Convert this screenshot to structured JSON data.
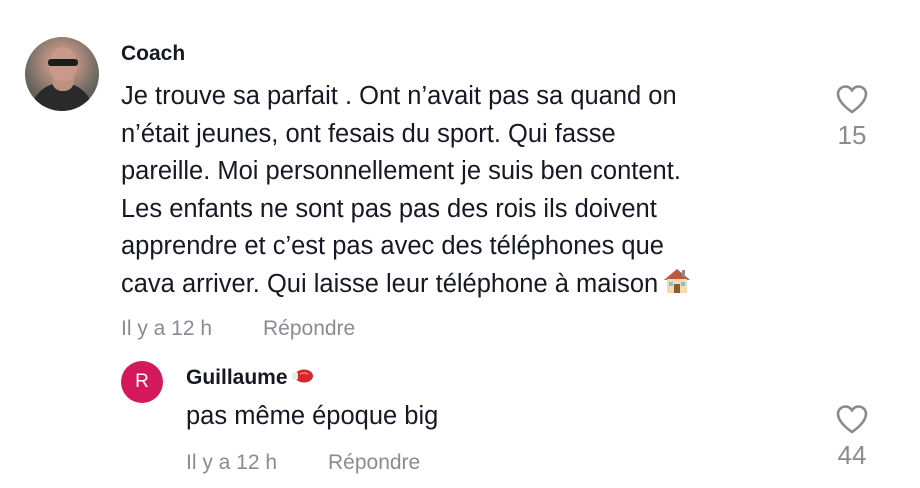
{
  "comment": {
    "username": "Coach",
    "text": "Je trouve sa parfait . Ont n’avait pas sa quand on\nn’était jeunes, ont fesais du sport. Qui fasse\npareille. Moi personnellement je suis ben content.\nLes enfants ne sont pas pas des rois ils doivent\napprendre et c’est pas avec des téléphones que\ncava arriver. Qui laisse leur téléphone à maison",
    "emoji": "house-icon",
    "timestamp": "Il y a 12 h",
    "reply_label": "Répondre",
    "like_count": "15",
    "like_icon": "heart-outline-icon"
  },
  "reply": {
    "avatar_letter": "R",
    "avatar_color": "#d4195a",
    "username": "Guillaume",
    "username_emoji": "boxing-glove-icon",
    "text": "pas même époque big",
    "timestamp": "Il y a 12 h",
    "reply_label": "Répondre",
    "like_count": "44",
    "like_icon": "heart-outline-icon"
  }
}
